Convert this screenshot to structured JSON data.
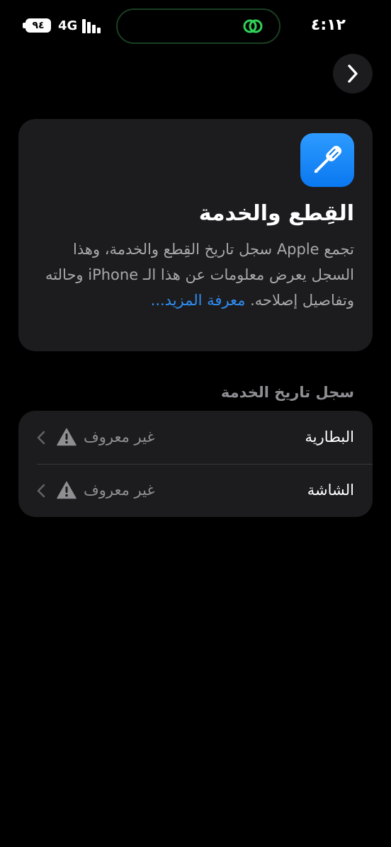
{
  "status_bar": {
    "battery_level": "٩٤",
    "network": "4G",
    "time": "٤:١٢"
  },
  "info_card": {
    "title": "القِطع والخدمة",
    "body": "تجمع Apple سجل تاريخ القِطع والخدمة، وهذا السجل يعرض معلومات عن هذا الـ iPhone وحالته وتفاصيل إصلاحه.",
    "learn_more": "معرفة المزيد..."
  },
  "service_history": {
    "header": "سجل تاريخ الخدمة",
    "items": [
      {
        "label": "البطارية",
        "status": "غير معروف"
      },
      {
        "label": "الشاشة",
        "status": "غير معروف"
      }
    ]
  },
  "colors": {
    "background": "#000000",
    "card": "#1c1c1e",
    "accent": "#2f8ef5",
    "secondary_text": "#8e8e93",
    "status_active": "#30d158"
  }
}
